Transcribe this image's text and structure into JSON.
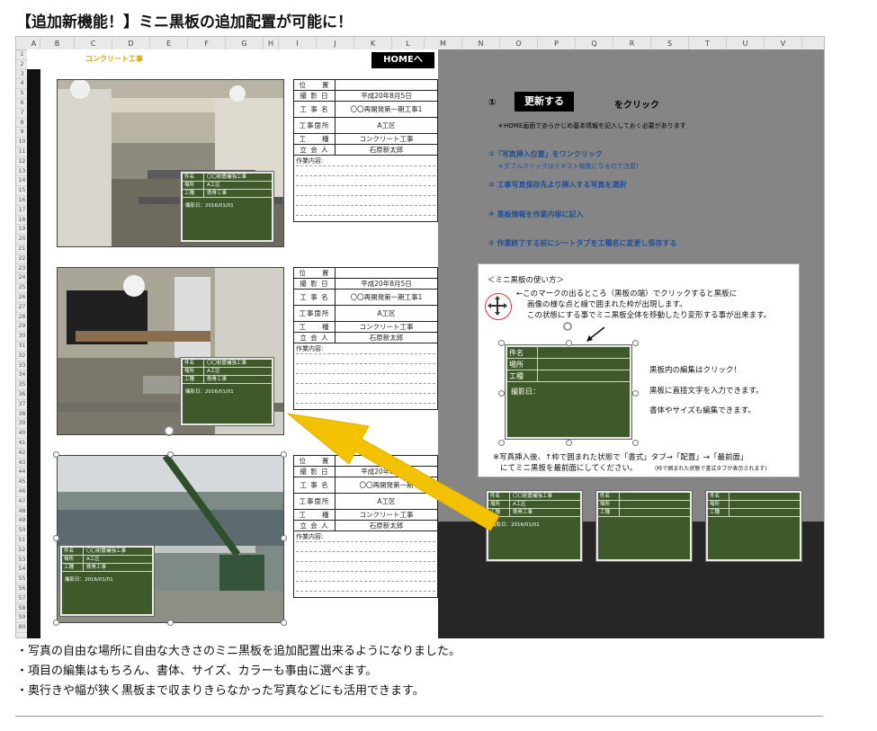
{
  "title": "【追加新機能！】ミニ黒板の追加配置が可能に！",
  "sheet": {
    "columns": [
      "A",
      "B",
      "C",
      "D",
      "E",
      "F",
      "G",
      "H",
      "I",
      "J",
      "K",
      "L",
      "M",
      "N",
      "O",
      "P",
      "Q",
      "R",
      "S",
      "T",
      "U",
      "V"
    ],
    "rows": [
      "1",
      "2",
      "3",
      "4",
      "5",
      "6",
      "7",
      "8",
      "9",
      "10",
      "11",
      "12",
      "13",
      "14",
      "15",
      "16",
      "17",
      "18",
      "19",
      "20",
      "21",
      "22",
      "23",
      "24",
      "25",
      "26",
      "27",
      "28",
      "29",
      "30",
      "31",
      "32",
      "33",
      "34",
      "35",
      "36",
      "37",
      "38",
      "39",
      "40",
      "41",
      "42",
      "43",
      "44",
      "45",
      "46",
      "47",
      "48",
      "49",
      "50",
      "51",
      "52",
      "53",
      "54",
      "55",
      "56",
      "57",
      "58",
      "59",
      "60"
    ]
  },
  "doc": {
    "title": "コンクリート工事",
    "home_button": "HOMEへ"
  },
  "info_tables": [
    {
      "position": "位　　置",
      "date_label": "撮 影 日",
      "date": "平成20年8月5日",
      "project_label": "工 事 名",
      "project": "〇〇再開発第一期工事1",
      "place_label": "工事箇所",
      "place": "A工区",
      "type_label": "工　　種",
      "type": "コンクリート工事",
      "witness_label": "立 会 人",
      "witness": "石原新太郎",
      "memo_label": "作業内容:"
    },
    {
      "position": "位　　置",
      "date_label": "撮 影 日",
      "date": "平成20年8月5日",
      "project_label": "工 事 名",
      "project": "〇〇再開発第一期工事1",
      "place_label": "工事箇所",
      "place": "A工区",
      "type_label": "工　　種",
      "type": "コンクリート工事",
      "witness_label": "立 会 人",
      "witness": "石原新太郎",
      "memo_label": "作業内容:"
    },
    {
      "position": "位　　置",
      "date_label": "撮 影 日",
      "date": "平成20年8月5日",
      "project_label": "工 事 名",
      "project": "〇〇再開発第一期",
      "place_label": "工事箇所",
      "place": "A工区",
      "type_label": "工　　種",
      "type": "コンクリート工事",
      "witness_label": "立 会 人",
      "witness": "石原新太郎",
      "memo_label": "作業内容:"
    }
  ],
  "board": {
    "name_label": "件名",
    "name": "〇〇耐震補強工事",
    "place_label": "場所",
    "place": "A工区",
    "type_label": "工種",
    "type": "鉄骨工事",
    "date": "撮影日：2016/01/01"
  },
  "right": {
    "step1_num": "①",
    "update_button": "更新する",
    "click_label": "をクリック",
    "note1": "＊HOME画面であらかじめ基本情報を記入しておく必要があります",
    "step2": "②「写真挿入位置」をワンクリック",
    "step2_sub": "＊ダブルクリックはテキスト編集になるので注意！",
    "step3": "③ 工事写真保存先より挿入する写真を選択",
    "step4": "④ 黒板情報を作業内容に記入",
    "step5": "⑤ 作業終了する前にシートタブを工種名に変更し保存する"
  },
  "howto": {
    "heading": "＜ミニ黒板の使い方＞",
    "line1": "←このマークの出るところ（黒板の端）でクリックすると黒板に",
    "line2": "画像の様な点と線で囲まれた枠が出現します。",
    "line3": "この状態にする事でミニ黒板全体を移動したり変形する事が出来ます。",
    "board_name_label": "件名",
    "board_place_label": "場所",
    "board_type_label": "工種",
    "board_date_label": "撮影日：",
    "edit1": "黒板内の編集はクリック！",
    "edit2": "黒板に直接文字を入力できます。",
    "edit3": "書体やサイズも編集できます。",
    "foot1": "※写真挿入後、↑枠で囲まれた状態で「書式」タブ→「配置」→「最前面」",
    "foot2": "にてミニ黒板を最前面にしてください。",
    "foot2_small": "(枠で囲まれた状態で書式タブが表示されます)"
  },
  "bottom": [
    "・写真の自由な場所に自由な大きさのミニ黒板を追加配置出来るようになりました。",
    "・項目の編集はもちろん、書体、サイズ、カラーも事由に選べます。",
    "・奥行きや幅が狭く黒板まで収まりきらなかった写真などにも活用できます。"
  ],
  "colors": {
    "board_green": "#3e5a2b",
    "arrow_yellow": "#f2c200",
    "step_blue": "#1b4fa0",
    "title_orange": "#d7a300"
  }
}
